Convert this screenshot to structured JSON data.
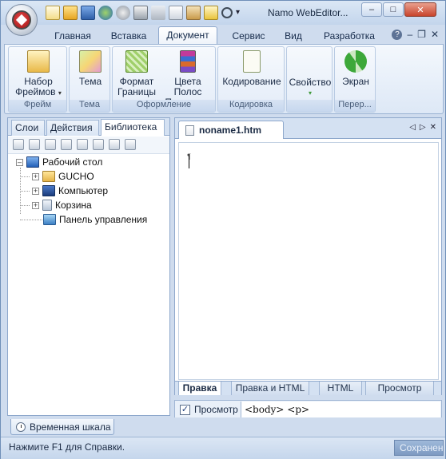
{
  "window": {
    "title": "Namo WebEditor...",
    "controls": {
      "minimize": "–",
      "maximize": "□",
      "close": "✕"
    }
  },
  "quick_access": [
    "new-file-icon",
    "open-folder-icon",
    "save-icon",
    "globe-icon",
    "gear-icon",
    "print-icon",
    "cut-icon",
    "copy-icon",
    "paste-icon",
    "edit-icon",
    "undo-icon"
  ],
  "ribbon_tabs": [
    "Главная",
    "Вставка",
    "Документ",
    "Сервис",
    "Вид",
    "Разработка"
  ],
  "active_tab": "Документ",
  "ribbon_tab_icons": {
    "help": "?",
    "minimize": "–",
    "restore": "❐",
    "close": "✕"
  },
  "ribbon_groups": [
    {
      "label": "Фрейм",
      "buttons": [
        {
          "label": "Набор Фреймов",
          "icon": "frameset-icon",
          "dropdown": true
        }
      ]
    },
    {
      "label": "Тема",
      "buttons": [
        {
          "label": "Тема",
          "icon": "theme-icon"
        }
      ]
    },
    {
      "label": "Оформление",
      "buttons": [
        {
          "label": "Формат Границы",
          "icon": "border-format-icon"
        },
        {
          "label": "Цвета Полос Прокрутки",
          "icon": "scrollbar-colors-icon"
        }
      ]
    },
    {
      "label": "Кодировка",
      "buttons": [
        {
          "label": "Кодирование",
          "icon": "encoding-icon"
        }
      ]
    },
    {
      "label": "",
      "buttons": [
        {
          "label": "Свойство",
          "icon": "properties-icon",
          "dropdown": true
        }
      ]
    },
    {
      "label": "Перер...",
      "buttons": [
        {
          "label": "Экран",
          "icon": "refresh-screen-icon"
        }
      ]
    }
  ],
  "left_panel": {
    "tabs": [
      "Слои",
      "Действия",
      "Библиотека"
    ],
    "active_tab": "Библиотека",
    "toolbar_icons": [
      "add-icon",
      "link-icon",
      "copy-icon",
      "folder-icon",
      "refresh-icon",
      "font-icon",
      "page-icon",
      "search-icon"
    ],
    "tree": [
      {
        "label": "Рабочий стол",
        "icon": "desktop-icon",
        "expander": "–",
        "level": 0
      },
      {
        "label": "GUCHO",
        "icon": "user-folder-icon",
        "expander": "+",
        "level": 1
      },
      {
        "label": "Компьютер",
        "icon": "computer-icon",
        "expander": "+",
        "level": 1
      },
      {
        "label": "Корзина",
        "icon": "recycle-bin-icon",
        "expander": "+",
        "level": 1
      },
      {
        "label": "Панель управления",
        "icon": "control-panel-icon",
        "expander": "",
        "level": 1
      }
    ]
  },
  "editor": {
    "document_tab": "noname1.htm",
    "nav": {
      "prev": "◁",
      "next": "▷",
      "close": "✕"
    },
    "view_tabs": [
      "Правка",
      "Правка и HTML",
      "HTML",
      "Просмотр"
    ],
    "active_view": "Правка"
  },
  "tagbar": {
    "preview_checked": true,
    "preview_label": "Просмотр",
    "path": "<body> <p>"
  },
  "timeline": {
    "label": "Временная шкала"
  },
  "status": {
    "text": "Нажмите F1 для Справки.",
    "save": "Сохранение"
  },
  "colors": {
    "frame": "#cfdcee",
    "accent": "#8ea8cc",
    "close_button": "#c8442c"
  }
}
